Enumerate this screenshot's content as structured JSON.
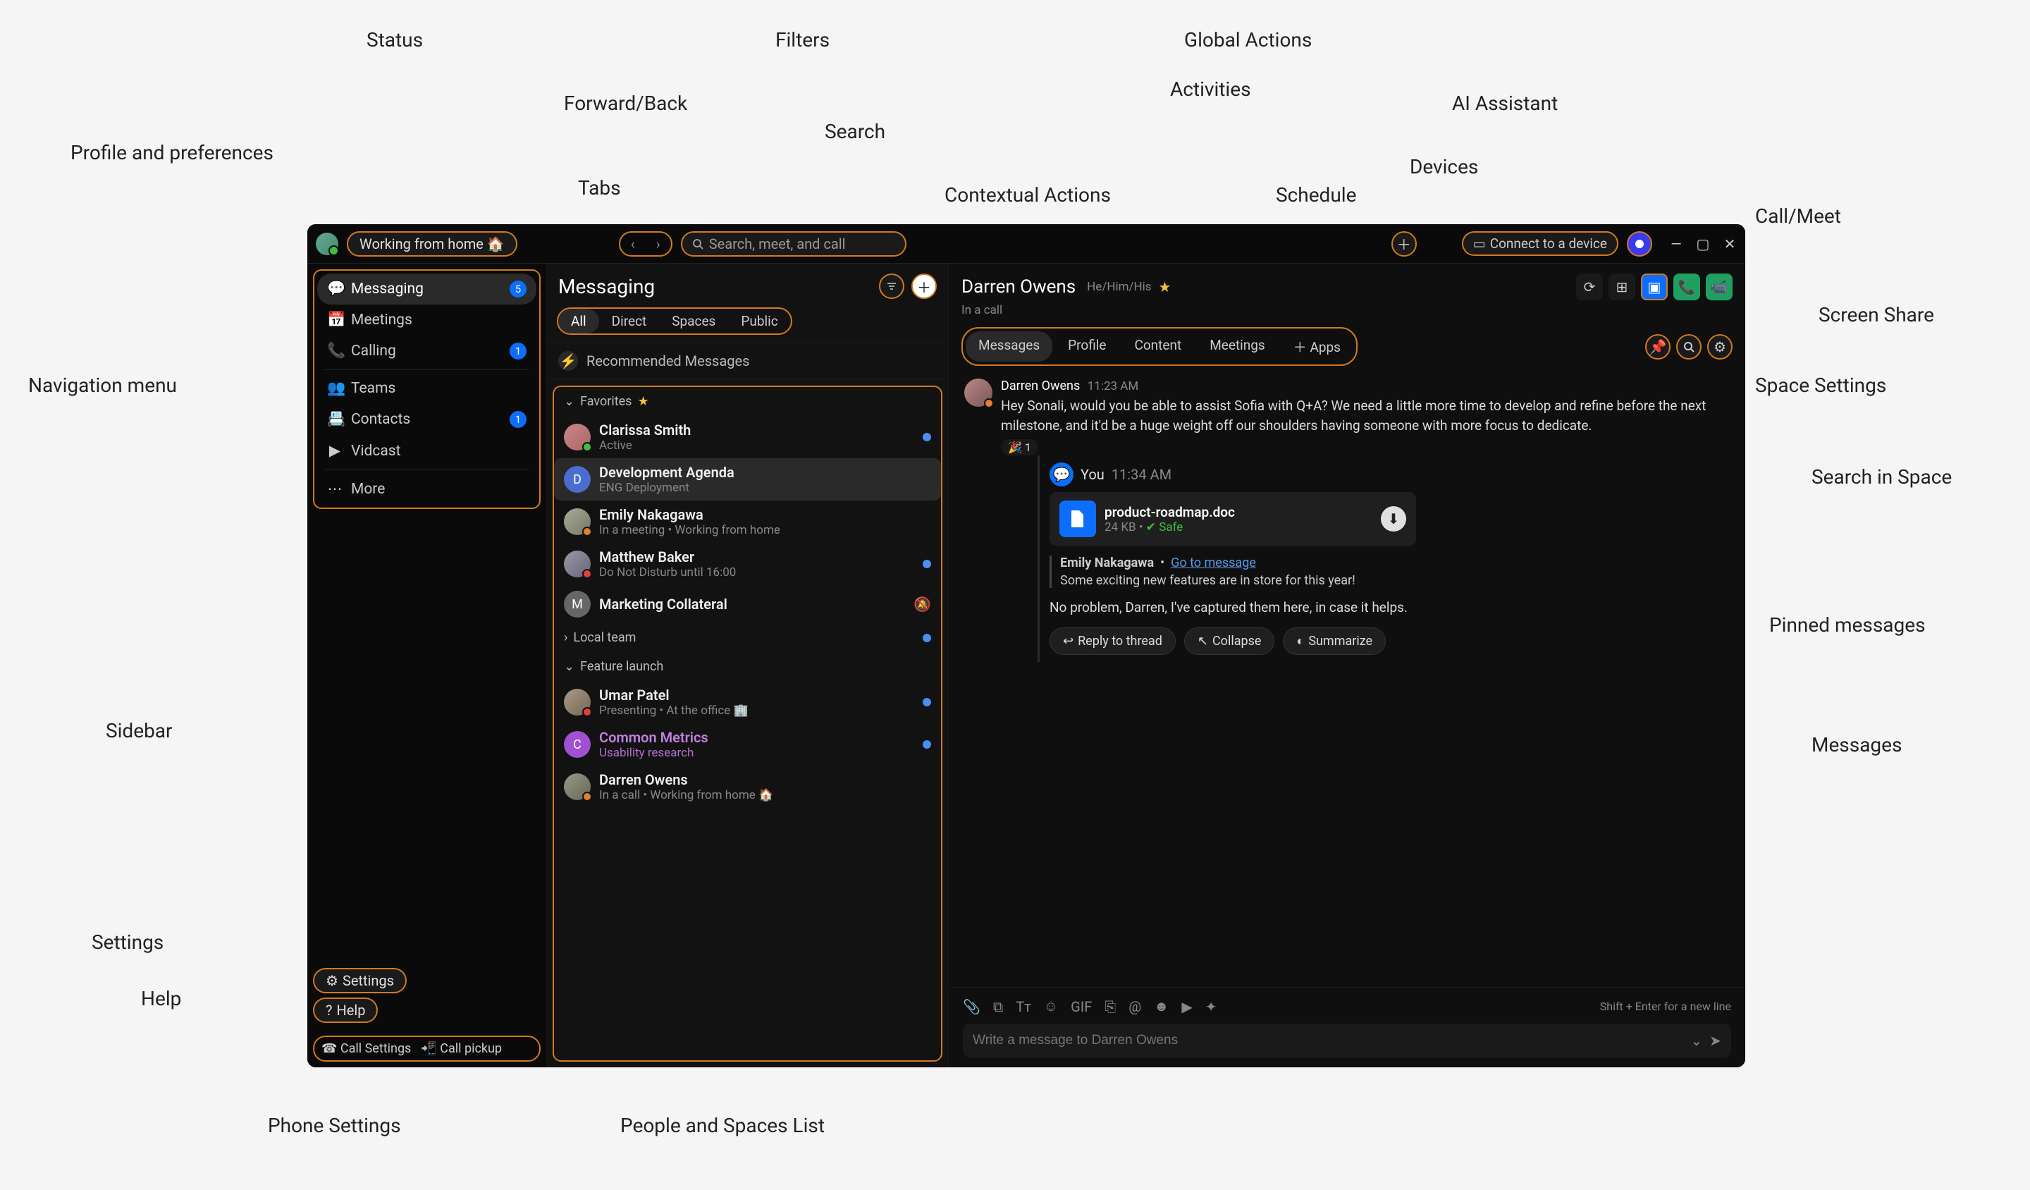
{
  "annotations": {
    "profile": "Profile and preferences",
    "status": "Status",
    "tabs": "Tabs",
    "fwdback": "Forward/Back",
    "filters": "Filters",
    "search": "Search",
    "ctxactions": "Contextual Actions",
    "activities": "Activities",
    "globalactions": "Global Actions",
    "schedule": "Schedule",
    "devices": "Devices",
    "aiassist": "AI Assistant",
    "callmeet": "Call/Meet",
    "screenshare": "Screen Share",
    "spacesettings": "Space Settings",
    "searchspace": "Search in Space",
    "pinnedmsgs": "Pinned messages",
    "messages": "Messages",
    "navmenu": "Navigation menu",
    "sidebar": "Sidebar",
    "settings": "Settings",
    "help": "Help",
    "phonesettings": "Phone Settings",
    "peoplespaces": "People and Spaces List"
  },
  "topbar": {
    "status": "Working from home 🏠",
    "search_placeholder": "Search, meet, and call",
    "connect_device": "Connect to a device"
  },
  "nav": {
    "items": [
      {
        "label": "Messaging",
        "badge": "5",
        "active": true
      },
      {
        "label": "Meetings"
      },
      {
        "label": "Calling",
        "badge": "1"
      },
      {
        "label": "Teams"
      },
      {
        "label": "Contacts",
        "badge": "1"
      },
      {
        "label": "Vidcast"
      },
      {
        "label": "More"
      }
    ],
    "settings": "Settings",
    "help": "Help",
    "call_settings": "Call Settings",
    "call_pickup": "Call pickup"
  },
  "mid": {
    "title": "Messaging",
    "tabs": [
      "All",
      "Direct",
      "Spaces",
      "Public"
    ],
    "recommended": "Recommended Messages",
    "favorites": "Favorites",
    "localteam": "Local team",
    "featurelaunch": "Feature launch",
    "items": {
      "clarissa": {
        "name": "Clarissa Smith",
        "sub": "Active"
      },
      "dev": {
        "name": "Development Agenda",
        "sub": "ENG Deployment"
      },
      "emily": {
        "name": "Emily Nakagawa",
        "sub": "In a meeting  •  Working from home"
      },
      "matthew": {
        "name": "Matthew Baker",
        "sub": "Do Not Disturb until 16:00"
      },
      "marketing": {
        "name": "Marketing Collateral"
      },
      "umar": {
        "name": "Umar Patel",
        "sub": "Presenting  •  At the office 🏢"
      },
      "common": {
        "name": "Common Metrics",
        "sub": "Usability research"
      },
      "darren": {
        "name": "Darren Owens",
        "sub": "In a call  •  Working from home 🏠"
      }
    }
  },
  "conv": {
    "name": "Darren Owens",
    "pronouns": "He/Him/His",
    "status": "In a call",
    "tabs": [
      "Messages",
      "Profile",
      "Content",
      "Meetings"
    ],
    "addapps": "Apps",
    "msg1": {
      "author": "Darren Owens",
      "time": "11:23 AM",
      "text": "Hey Sonali, would you be able to assist Sofia with Q+A? We need a little more time to develop and refine before the next milestone, and it'd be a huge weight off our shoulders having someone with more focus to dedicate.",
      "reaction_count": "1"
    },
    "reply": {
      "author": "You",
      "time": "11:34 AM",
      "filename": "product-roadmap.doc",
      "filesize": "24 KB",
      "filesafe": "Safe",
      "quote_author": "Emily Nakagawa",
      "quote_link": "Go to message",
      "quote_text": "Some exciting new features are in store for this year!",
      "text": "No problem, Darren, I've captured them here, in case it helps."
    },
    "actions": {
      "reply": "Reply to thread",
      "collapse": "Collapse",
      "summarize": "Summarize"
    }
  },
  "composer": {
    "hint": "Shift + Enter for a new line",
    "placeholder": "Write a message to Darren Owens"
  }
}
